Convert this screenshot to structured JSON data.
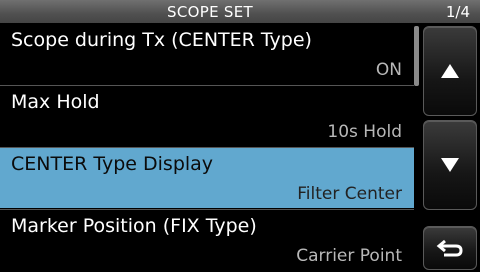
{
  "header": {
    "title": "SCOPE SET",
    "page": "1/4"
  },
  "items": [
    {
      "label": "Scope during Tx (CENTER Type)",
      "value": "ON"
    },
    {
      "label": "Max Hold",
      "value": "10s Hold"
    },
    {
      "label": "CENTER Type Display",
      "value": "Filter Center"
    },
    {
      "label": "Marker Position (FIX Type)",
      "value": "Carrier Point"
    }
  ],
  "selected_index": 2,
  "scroll": {
    "position_fraction": 0.0
  },
  "buttons": {
    "up_icon": "triangle-up-icon",
    "down_icon": "triangle-down-icon",
    "back_icon": "return-arrow-icon"
  }
}
